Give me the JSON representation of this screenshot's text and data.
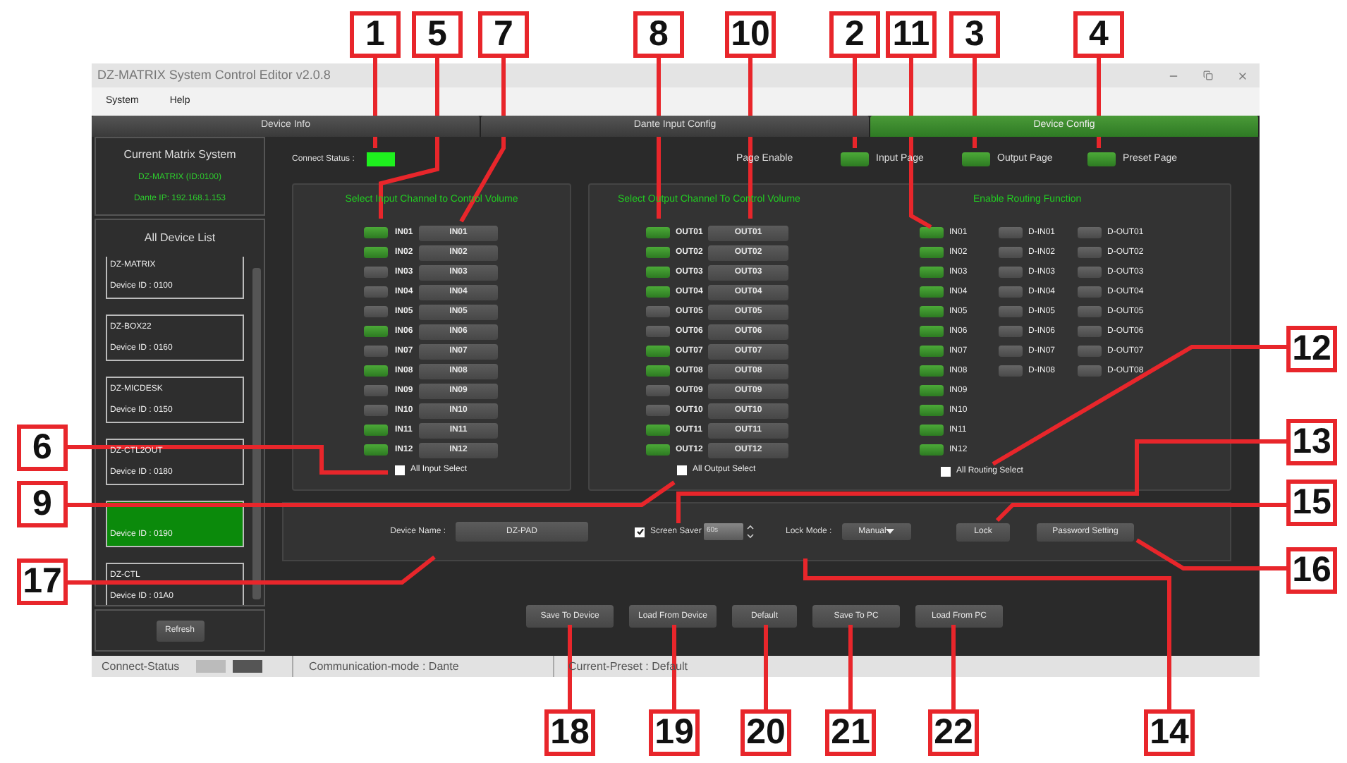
{
  "window": {
    "title": "DZ-MATRIX System Control Editor v2.0.8"
  },
  "menu": [
    "System",
    "Help"
  ],
  "tabs": [
    {
      "label": "Device Info",
      "selected": false
    },
    {
      "label": "Dante Input Config",
      "selected": false
    },
    {
      "label": "Device Config",
      "selected": true
    }
  ],
  "sidebar": {
    "current_system": {
      "title": "Current Matrix System",
      "device": "DZ-MATRIX (ID:0100)",
      "dante_ip": "Dante IP: 192.168.1.153"
    },
    "device_list": {
      "title": "All Device List",
      "devices": [
        {
          "name": "DZ-MATRIX",
          "device_id": "Device ID :  0100",
          "selected": false
        },
        {
          "name": "DZ-BOX22",
          "device_id": "Device ID :  0160",
          "selected": false
        },
        {
          "name": "DZ-MICDESK",
          "device_id": "Device ID :  0150",
          "selected": false
        },
        {
          "name": "DZ-CTL2OUT",
          "device_id": "Device ID :  0180",
          "selected": false
        },
        {
          "device_id": "Device ID :  0190",
          "selected": true
        },
        {
          "name": "DZ-CTL",
          "device_id": "Device ID :  01A0",
          "selected": false
        }
      ]
    },
    "refresh_button": "Refresh"
  },
  "connect_status": {
    "label": "Connect Status :",
    "connected": true
  },
  "page_enable": {
    "label": "Page Enable",
    "pages": [
      {
        "label": "Input Page",
        "on": true
      },
      {
        "label": "Output Page",
        "on": true
      },
      {
        "label": "Preset Page",
        "on": true
      }
    ]
  },
  "input_panel": {
    "title": "Select Input Channel to Control Volume",
    "channels": [
      {
        "label": "IN01",
        "button": "IN01",
        "on": true
      },
      {
        "label": "IN02",
        "button": "IN02",
        "on": true
      },
      {
        "label": "IN03",
        "button": "IN03",
        "on": false
      },
      {
        "label": "IN04",
        "button": "IN04",
        "on": false
      },
      {
        "label": "IN05",
        "button": "IN05",
        "on": false
      },
      {
        "label": "IN06",
        "button": "IN06",
        "on": true
      },
      {
        "label": "IN07",
        "button": "IN07",
        "on": false
      },
      {
        "label": "IN08",
        "button": "IN08",
        "on": true
      },
      {
        "label": "IN09",
        "button": "IN09",
        "on": false
      },
      {
        "label": "IN10",
        "button": "IN10",
        "on": false
      },
      {
        "label": "IN11",
        "button": "IN11",
        "on": true
      },
      {
        "label": "IN12",
        "button": "IN12",
        "on": true
      }
    ],
    "select_all": {
      "label": "All Input Select",
      "checked": false
    }
  },
  "output_panel": {
    "title": "Select Output Channel To Control Volume",
    "channels": [
      {
        "label": "OUT01",
        "button": "OUT01",
        "on": true
      },
      {
        "label": "OUT02",
        "button": "OUT02",
        "on": true
      },
      {
        "label": "OUT03",
        "button": "OUT03",
        "on": true
      },
      {
        "label": "OUT04",
        "button": "OUT04",
        "on": true
      },
      {
        "label": "OUT05",
        "button": "OUT05",
        "on": false
      },
      {
        "label": "OUT06",
        "button": "OUT06",
        "on": false
      },
      {
        "label": "OUT07",
        "button": "OUT07",
        "on": true
      },
      {
        "label": "OUT08",
        "button": "OUT08",
        "on": true
      },
      {
        "label": "OUT09",
        "button": "OUT09",
        "on": false
      },
      {
        "label": "OUT10",
        "button": "OUT10",
        "on": false
      },
      {
        "label": "OUT11",
        "button": "OUT11",
        "on": true
      },
      {
        "label": "OUT12",
        "button": "OUT12",
        "on": true
      }
    ],
    "select_all": {
      "label": "All Output Select",
      "checked": false
    }
  },
  "routing_panel": {
    "title": "Enable Routing Function",
    "columns": [
      [
        {
          "label": "IN01",
          "on": true
        },
        {
          "label": "IN02",
          "on": true
        },
        {
          "label": "IN03",
          "on": true
        },
        {
          "label": "IN04",
          "on": true
        },
        {
          "label": "IN05",
          "on": true
        },
        {
          "label": "IN06",
          "on": true
        },
        {
          "label": "IN07",
          "on": true
        },
        {
          "label": "IN08",
          "on": true
        },
        {
          "label": "IN09",
          "on": true
        },
        {
          "label": "IN10",
          "on": true
        },
        {
          "label": "IN11",
          "on": true
        },
        {
          "label": "IN12",
          "on": true
        }
      ],
      [
        {
          "label": "D-IN01",
          "on": false
        },
        {
          "label": "D-IN02",
          "on": false
        },
        {
          "label": "D-IN03",
          "on": false
        },
        {
          "label": "D-IN04",
          "on": false
        },
        {
          "label": "D-IN05",
          "on": false
        },
        {
          "label": "D-IN06",
          "on": false
        },
        {
          "label": "D-IN07",
          "on": false
        },
        {
          "label": "D-IN08",
          "on": false
        }
      ],
      [
        {
          "label": "D-OUT01",
          "on": false
        },
        {
          "label": "D-OUT02",
          "on": false
        },
        {
          "label": "D-OUT03",
          "on": false
        },
        {
          "label": "D-OUT04",
          "on": false
        },
        {
          "label": "D-OUT05",
          "on": false
        },
        {
          "label": "D-OUT06",
          "on": false
        },
        {
          "label": "D-OUT07",
          "on": false
        },
        {
          "label": "D-OUT08",
          "on": false
        }
      ]
    ],
    "select_all": {
      "label": "All Routing Select",
      "checked": false
    }
  },
  "device_settings": {
    "device_name_label": "Device Name :",
    "device_name": "DZ-PAD",
    "screen_saver": {
      "label": "Screen Saver",
      "checked": true,
      "value": "60s"
    },
    "lock_mode": {
      "label": "Lock Mode :",
      "value": "Manual"
    },
    "lock_button": "Lock",
    "password_button": "Password Setting"
  },
  "actions": [
    "Save To Device",
    "Load From Device",
    "Default",
    "Save To PC",
    "Load From PC"
  ],
  "status_bar": {
    "connect_status": "Connect-Status",
    "communication_mode": "Communication-mode : Dante",
    "current_preset": "Current-Preset : Default"
  },
  "callouts": [
    "1",
    "5",
    "7",
    "8",
    "10",
    "2",
    "11",
    "3",
    "4",
    "12",
    "13",
    "15",
    "16",
    "6",
    "9",
    "17",
    "18",
    "19",
    "20",
    "21",
    "22",
    "14"
  ]
}
